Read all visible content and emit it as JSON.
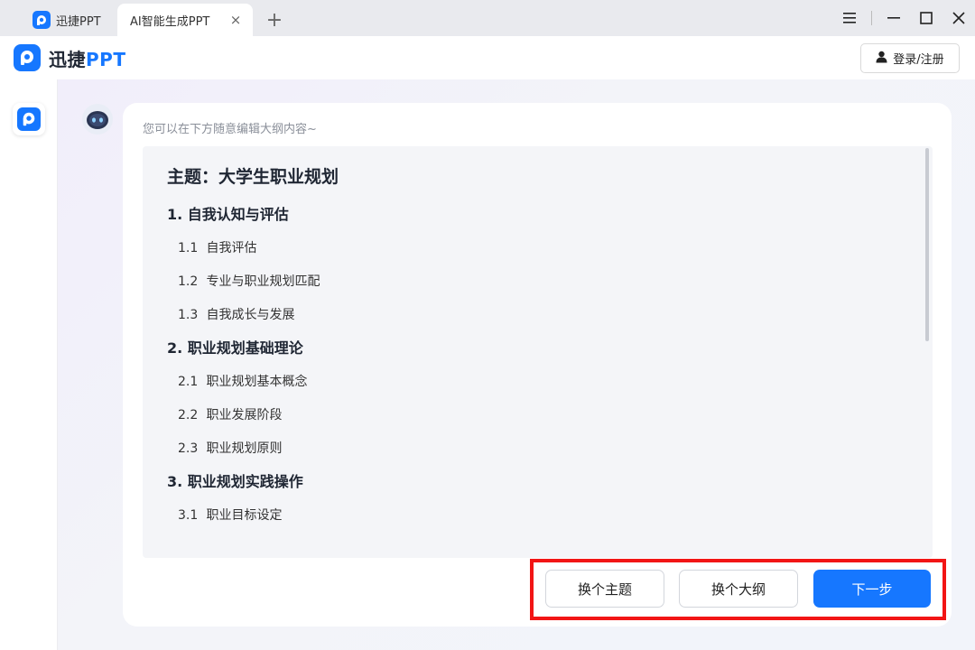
{
  "titlebar": {
    "tabs": [
      {
        "label": "迅捷PPT"
      },
      {
        "label": "AI智能生成PPT"
      }
    ],
    "close_glyph": "×",
    "add_glyph": "+"
  },
  "appbar": {
    "brand_prefix": "迅捷",
    "brand_suffix": "PPT",
    "login_label": "登录/注册"
  },
  "main": {
    "hint": "您可以在下方随意编辑大纲内容~",
    "outline": {
      "title": "主题：大学生职业规划",
      "sections": [
        {
          "label": "1. 自我认知与评估",
          "items": [
            {
              "num": "1.1",
              "text": "自我评估"
            },
            {
              "num": "1.2",
              "text": "专业与职业规划匹配"
            },
            {
              "num": "1.3",
              "text": "自我成长与发展"
            }
          ]
        },
        {
          "label": "2. 职业规划基础理论",
          "items": [
            {
              "num": "2.1",
              "text": "职业规划基本概念"
            },
            {
              "num": "2.2",
              "text": "职业发展阶段"
            },
            {
              "num": "2.3",
              "text": "职业规划原则"
            }
          ]
        },
        {
          "label": "3. 职业规划实践操作",
          "items": [
            {
              "num": "3.1",
              "text": "职业目标设定"
            }
          ]
        }
      ]
    },
    "buttons": {
      "change_topic": "换个主题",
      "change_outline": "换个大纲",
      "next": "下一步"
    }
  },
  "colors": {
    "accent": "#1677ff",
    "highlight": "#f21515"
  },
  "icons": [
    "app-logo-icon",
    "close-icon",
    "plus-icon",
    "menu-icon",
    "minimize-icon",
    "maximize-icon",
    "window-close-icon",
    "user-icon",
    "robot-avatar-icon"
  ]
}
